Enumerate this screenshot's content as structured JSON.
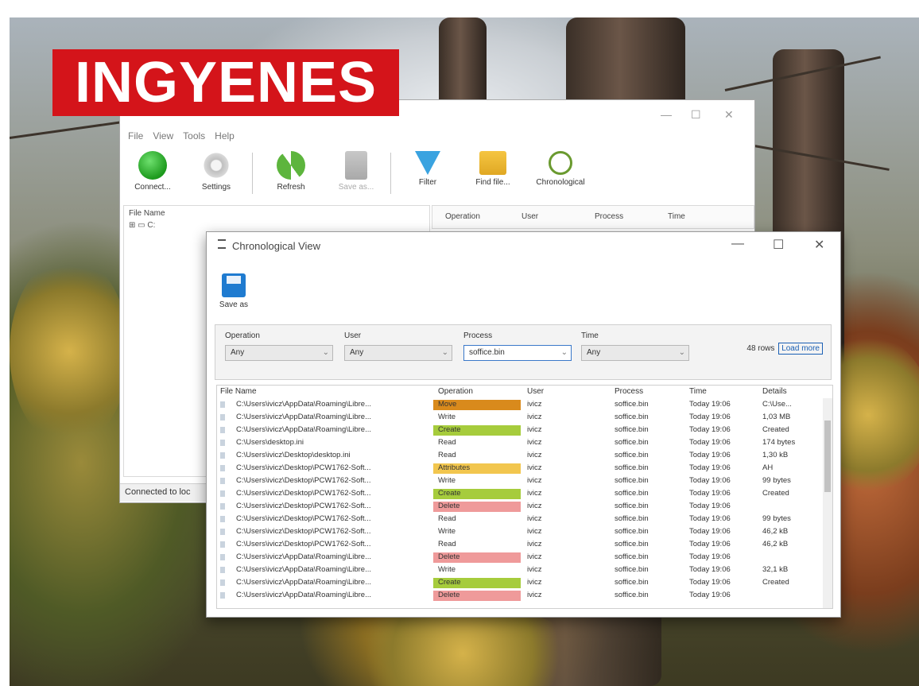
{
  "badge": "INGYENES",
  "main_window": {
    "title_controls": {
      "minimize": "—",
      "maximize": "☐",
      "close": "✕"
    },
    "menu": [
      "File",
      "View",
      "Tools",
      "Help"
    ],
    "toolbar": [
      {
        "label": "Connect...",
        "icon": "connect-icon"
      },
      {
        "label": "Settings",
        "icon": "gear-icon"
      },
      {
        "label": "Refresh",
        "icon": "refresh-icon"
      },
      {
        "label": "Save as...",
        "icon": "save-icon"
      },
      {
        "label": "Filter",
        "icon": "filter-icon"
      },
      {
        "label": "Find file...",
        "icon": "find-file-icon"
      },
      {
        "label": "Chronological",
        "icon": "clock-icon"
      }
    ],
    "left_header": "File Name",
    "tree_root": "C:",
    "right_headers": [
      "Operation",
      "User",
      "Process",
      "Time"
    ],
    "status": "Connected to loc"
  },
  "chrono_window": {
    "title": "Chronological View",
    "controls": {
      "minimize": "—",
      "maximize": "☐",
      "close": "✕"
    },
    "save_as": "Save as",
    "filters": [
      {
        "label": "Operation",
        "value": "Any"
      },
      {
        "label": "User",
        "value": "Any"
      },
      {
        "label": "Process",
        "value": "soffice.bin"
      },
      {
        "label": "Time",
        "value": "Any"
      }
    ],
    "rows_info": "48 rows",
    "load_more": "Load more",
    "columns": [
      "File Name",
      "Operation",
      "User",
      "Process",
      "Time",
      "Details"
    ],
    "rows": [
      {
        "file": "C:\\Users\\ivicz\\AppData\\Roaming\\Libre...",
        "op": "Move",
        "user": "ivicz",
        "process": "soffice.bin",
        "time": "Today 19:06",
        "details": "C:\\Use..."
      },
      {
        "file": "C:\\Users\\ivicz\\AppData\\Roaming\\Libre...",
        "op": "Write",
        "user": "ivicz",
        "process": "soffice.bin",
        "time": "Today 19:06",
        "details": "1,03 MB"
      },
      {
        "file": "C:\\Users\\ivicz\\AppData\\Roaming\\Libre...",
        "op": "Create",
        "user": "ivicz",
        "process": "soffice.bin",
        "time": "Today 19:06",
        "details": "Created"
      },
      {
        "file": "C:\\Users\\desktop.ini",
        "op": "Read",
        "user": "ivicz",
        "process": "soffice.bin",
        "time": "Today 19:06",
        "details": "174 bytes"
      },
      {
        "file": "C:\\Users\\ivicz\\Desktop\\desktop.ini",
        "op": "Read",
        "user": "ivicz",
        "process": "soffice.bin",
        "time": "Today 19:06",
        "details": "1,30 kB"
      },
      {
        "file": "C:\\Users\\ivicz\\Desktop\\PCW1762-Soft...",
        "op": "Attributes",
        "user": "ivicz",
        "process": "soffice.bin",
        "time": "Today 19:06",
        "details": "AH"
      },
      {
        "file": "C:\\Users\\ivicz\\Desktop\\PCW1762-Soft...",
        "op": "Write",
        "user": "ivicz",
        "process": "soffice.bin",
        "time": "Today 19:06",
        "details": "99 bytes"
      },
      {
        "file": "C:\\Users\\ivicz\\Desktop\\PCW1762-Soft...",
        "op": "Create",
        "user": "ivicz",
        "process": "soffice.bin",
        "time": "Today 19:06",
        "details": "Created"
      },
      {
        "file": "C:\\Users\\ivicz\\Desktop\\PCW1762-Soft...",
        "op": "Delete",
        "user": "ivicz",
        "process": "soffice.bin",
        "time": "Today 19:06",
        "details": ""
      },
      {
        "file": "C:\\Users\\ivicz\\Desktop\\PCW1762-Soft...",
        "op": "Read",
        "user": "ivicz",
        "process": "soffice.bin",
        "time": "Today 19:06",
        "details": "99 bytes"
      },
      {
        "file": "C:\\Users\\ivicz\\Desktop\\PCW1762-Soft...",
        "op": "Write",
        "user": "ivicz",
        "process": "soffice.bin",
        "time": "Today 19:06",
        "details": "46,2 kB"
      },
      {
        "file": "C:\\Users\\ivicz\\Desktop\\PCW1762-Soft...",
        "op": "Read",
        "user": "ivicz",
        "process": "soffice.bin",
        "time": "Today 19:06",
        "details": "46,2 kB"
      },
      {
        "file": "C:\\Users\\ivicz\\AppData\\Roaming\\Libre...",
        "op": "Delete",
        "user": "ivicz",
        "process": "soffice.bin",
        "time": "Today 19:06",
        "details": ""
      },
      {
        "file": "C:\\Users\\ivicz\\AppData\\Roaming\\Libre...",
        "op": "Write",
        "user": "ivicz",
        "process": "soffice.bin",
        "time": "Today 19:06",
        "details": "32,1 kB"
      },
      {
        "file": "C:\\Users\\ivicz\\AppData\\Roaming\\Libre...",
        "op": "Create",
        "user": "ivicz",
        "process": "soffice.bin",
        "time": "Today 19:06",
        "details": "Created"
      },
      {
        "file": "C:\\Users\\ivicz\\AppData\\Roaming\\Libre...",
        "op": "Delete",
        "user": "ivicz",
        "process": "soffice.bin",
        "time": "Today 19:06",
        "details": ""
      }
    ]
  },
  "colors": {
    "badge_red": "#d4141a",
    "op_move": "#d98a1c",
    "op_create": "#a6cc3c",
    "op_attributes": "#f2c64e",
    "op_delete": "#ef9a9a",
    "link_blue": "#1a5fb4"
  }
}
